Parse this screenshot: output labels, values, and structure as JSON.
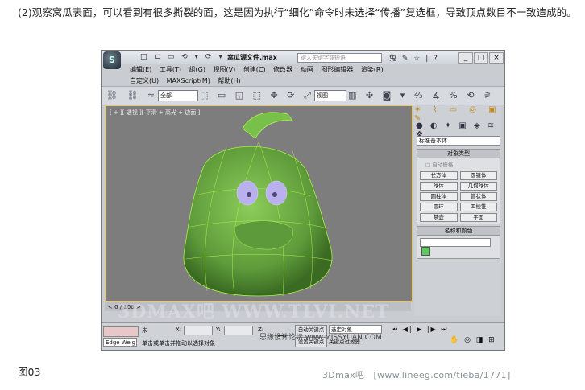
{
  "article": {
    "paragraph": "(2)观察窝瓜表面，可以看到有很多撕裂的面，这是因为执行“细化”命令时未选择“传播”复选框，导致顶点数目不一致造成的。",
    "figure_caption": "图03",
    "footer": "3Dmax吧　[www.lineeg.com/tieba/1771]"
  },
  "app": {
    "logo": "S",
    "quick_access": "□ ⊏ ▭ ⟲ ▾ ⟳ ▾",
    "title": "窝瓜源文件.max",
    "search_placeholder": "键入关键字或短语",
    "title_tools": "兔 ✎ ☆ | ?",
    "window_buttons": [
      "_",
      "□",
      "×"
    ],
    "menu": [
      "编辑(E)",
      "工具(T)",
      "组(G)",
      "视图(V)",
      "创建(C)",
      "修改器",
      "动画",
      "图形编辑器",
      "渲染(R)",
      "自定义(U)",
      "MAXScript(M)",
      "帮助(H)"
    ],
    "filter": "全部",
    "ref_coord": "视图",
    "viewport_label": "[ + ][ 透视 ][ 平滑 + 高光 + 边面 ]",
    "cmd_tabs": "✶ ⌇ ▭ ◎ ▣ ✎",
    "cmd_subtabs": "● ◐ ✦ ▣ ◈ ≋ ❖",
    "category": "标准基本体",
    "object_type_header": "对象类型",
    "autogrid": "□ 自动栅格",
    "primitives": [
      "长方体",
      "圆锥体",
      "球体",
      "几何球体",
      "圆柱体",
      "管状体",
      "圆环",
      "四棱锥",
      "茶壶",
      "平面"
    ],
    "name_color_header": "名称和颜色",
    "timeline": "< 0 / 100 >",
    "status_sel": "Edge Weig",
    "status_none": "未",
    "status_prompt": "单击或单击并拖动以选择对象",
    "coord_x": "X:",
    "coord_y": "Y:",
    "coord_z": "Z:",
    "auto_key": "自动关键点",
    "set_key": "设置关键点",
    "selected_obj": "选定对象",
    "key_filter": "关键点过滤器...",
    "playback": "⏮ ◀| ▶ |▶ ⏭",
    "nav_icons": "✋ ◎ ◨ ⊞",
    "watermark": "3DMAX吧 WWW.TLVI.NET",
    "watermark2": "思缘设计论坛 www.MISSYUAN.COM",
    "colors": {
      "viewport_bg": "#7d7d7d",
      "gourd_green": "#6fb04a",
      "wire_green": "#a8ee4a",
      "eye_purple": "#b9b0ee",
      "accent_orange": "#f2c94c"
    }
  }
}
